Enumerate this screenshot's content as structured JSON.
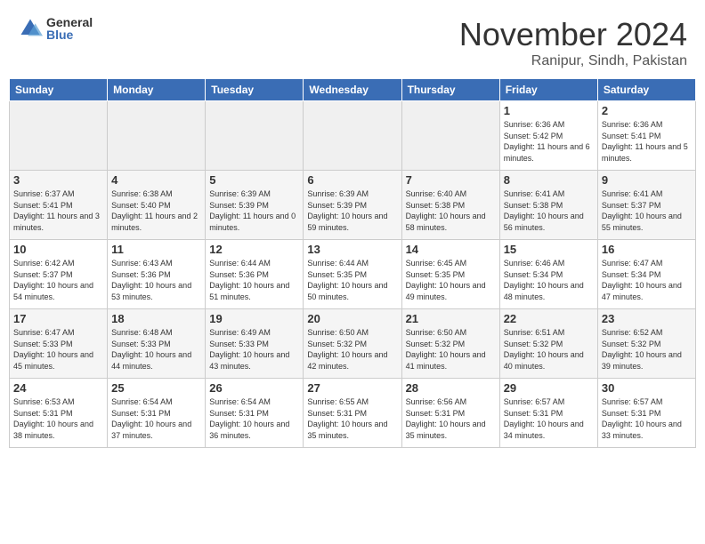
{
  "header": {
    "logo_general": "General",
    "logo_blue": "Blue",
    "month_title": "November 2024",
    "location": "Ranipur, Sindh, Pakistan"
  },
  "calendar": {
    "days_of_week": [
      "Sunday",
      "Monday",
      "Tuesday",
      "Wednesday",
      "Thursday",
      "Friday",
      "Saturday"
    ],
    "cells": [
      {
        "day": "",
        "empty": true
      },
      {
        "day": "",
        "empty": true
      },
      {
        "day": "",
        "empty": true
      },
      {
        "day": "",
        "empty": true
      },
      {
        "day": "",
        "empty": true
      },
      {
        "day": "1",
        "sunrise": "6:36 AM",
        "sunset": "5:42 PM",
        "daylight": "11 hours and 6 minutes."
      },
      {
        "day": "2",
        "sunrise": "6:36 AM",
        "sunset": "5:41 PM",
        "daylight": "11 hours and 5 minutes."
      },
      {
        "day": "3",
        "sunrise": "6:37 AM",
        "sunset": "5:41 PM",
        "daylight": "11 hours and 3 minutes."
      },
      {
        "day": "4",
        "sunrise": "6:38 AM",
        "sunset": "5:40 PM",
        "daylight": "11 hours and 2 minutes."
      },
      {
        "day": "5",
        "sunrise": "6:39 AM",
        "sunset": "5:39 PM",
        "daylight": "11 hours and 0 minutes."
      },
      {
        "day": "6",
        "sunrise": "6:39 AM",
        "sunset": "5:39 PM",
        "daylight": "10 hours and 59 minutes."
      },
      {
        "day": "7",
        "sunrise": "6:40 AM",
        "sunset": "5:38 PM",
        "daylight": "10 hours and 58 minutes."
      },
      {
        "day": "8",
        "sunrise": "6:41 AM",
        "sunset": "5:38 PM",
        "daylight": "10 hours and 56 minutes."
      },
      {
        "day": "9",
        "sunrise": "6:41 AM",
        "sunset": "5:37 PM",
        "daylight": "10 hours and 55 minutes."
      },
      {
        "day": "10",
        "sunrise": "6:42 AM",
        "sunset": "5:37 PM",
        "daylight": "10 hours and 54 minutes."
      },
      {
        "day": "11",
        "sunrise": "6:43 AM",
        "sunset": "5:36 PM",
        "daylight": "10 hours and 53 minutes."
      },
      {
        "day": "12",
        "sunrise": "6:44 AM",
        "sunset": "5:36 PM",
        "daylight": "10 hours and 51 minutes."
      },
      {
        "day": "13",
        "sunrise": "6:44 AM",
        "sunset": "5:35 PM",
        "daylight": "10 hours and 50 minutes."
      },
      {
        "day": "14",
        "sunrise": "6:45 AM",
        "sunset": "5:35 PM",
        "daylight": "10 hours and 49 minutes."
      },
      {
        "day": "15",
        "sunrise": "6:46 AM",
        "sunset": "5:34 PM",
        "daylight": "10 hours and 48 minutes."
      },
      {
        "day": "16",
        "sunrise": "6:47 AM",
        "sunset": "5:34 PM",
        "daylight": "10 hours and 47 minutes."
      },
      {
        "day": "17",
        "sunrise": "6:47 AM",
        "sunset": "5:33 PM",
        "daylight": "10 hours and 45 minutes."
      },
      {
        "day": "18",
        "sunrise": "6:48 AM",
        "sunset": "5:33 PM",
        "daylight": "10 hours and 44 minutes."
      },
      {
        "day": "19",
        "sunrise": "6:49 AM",
        "sunset": "5:33 PM",
        "daylight": "10 hours and 43 minutes."
      },
      {
        "day": "20",
        "sunrise": "6:50 AM",
        "sunset": "5:32 PM",
        "daylight": "10 hours and 42 minutes."
      },
      {
        "day": "21",
        "sunrise": "6:50 AM",
        "sunset": "5:32 PM",
        "daylight": "10 hours and 41 minutes."
      },
      {
        "day": "22",
        "sunrise": "6:51 AM",
        "sunset": "5:32 PM",
        "daylight": "10 hours and 40 minutes."
      },
      {
        "day": "23",
        "sunrise": "6:52 AM",
        "sunset": "5:32 PM",
        "daylight": "10 hours and 39 minutes."
      },
      {
        "day": "24",
        "sunrise": "6:53 AM",
        "sunset": "5:31 PM",
        "daylight": "10 hours and 38 minutes."
      },
      {
        "day": "25",
        "sunrise": "6:54 AM",
        "sunset": "5:31 PM",
        "daylight": "10 hours and 37 minutes."
      },
      {
        "day": "26",
        "sunrise": "6:54 AM",
        "sunset": "5:31 PM",
        "daylight": "10 hours and 36 minutes."
      },
      {
        "day": "27",
        "sunrise": "6:55 AM",
        "sunset": "5:31 PM",
        "daylight": "10 hours and 35 minutes."
      },
      {
        "day": "28",
        "sunrise": "6:56 AM",
        "sunset": "5:31 PM",
        "daylight": "10 hours and 35 minutes."
      },
      {
        "day": "29",
        "sunrise": "6:57 AM",
        "sunset": "5:31 PM",
        "daylight": "10 hours and 34 minutes."
      },
      {
        "day": "30",
        "sunrise": "6:57 AM",
        "sunset": "5:31 PM",
        "daylight": "10 hours and 33 minutes."
      }
    ]
  }
}
